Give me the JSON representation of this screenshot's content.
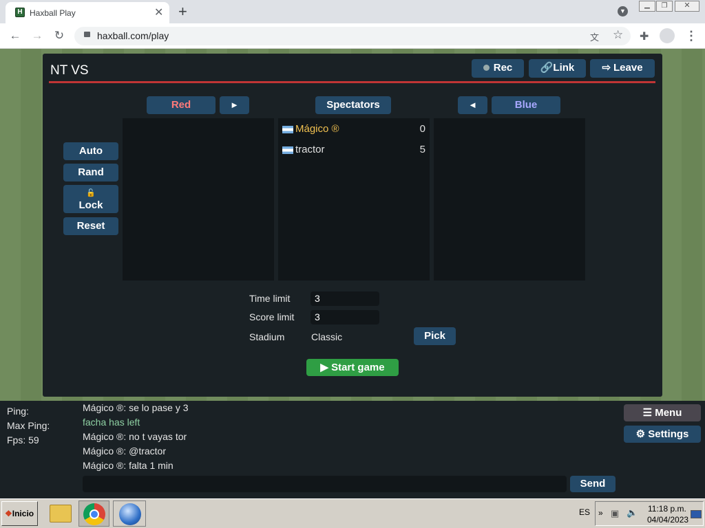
{
  "browser": {
    "tab_title": "Haxball Play",
    "url": "haxball.com/play"
  },
  "room": {
    "title": "NT VS",
    "rec_label": "Rec",
    "link_label": "Link",
    "leave_label": "Leave"
  },
  "teams": {
    "red_label": "Red",
    "red_arrow": "►",
    "spectators_label": "Spectators",
    "blue_arrow": "◄",
    "blue_label": "Blue"
  },
  "side_buttons": {
    "auto": "Auto",
    "rand": "Rand",
    "lock": "Lock",
    "reset": "Reset"
  },
  "spectators": [
    {
      "name": "Mágico ®",
      "score": "0"
    },
    {
      "name": "tractor",
      "score": "5"
    }
  ],
  "settings": {
    "time_limit_label": "Time limit",
    "time_limit_value": "3",
    "score_limit_label": "Score limit",
    "score_limit_value": "3",
    "stadium_label": "Stadium",
    "stadium_value": "Classic",
    "pick_label": "Pick"
  },
  "start_label": "▶ Start game",
  "stats": {
    "ping": "Ping:",
    "max_ping": "Max Ping:",
    "fps": "Fps: 59"
  },
  "chat": [
    "Mágico ®: se lo pase y 3",
    "facha has left",
    "Mágico ®: no t vayas tor",
    "Mágico ®: @tractor",
    "Mágico ®: falta 1 min"
  ],
  "send_label": "Send",
  "menu_label": "Menu",
  "settings_label": "Settings",
  "taskbar": {
    "start": "Inicio",
    "lang": "ES",
    "time": "11:18 p.m.",
    "date": "04/04/2023"
  },
  "colors": {
    "red_team": "#ff7a7a",
    "blue_team": "#a8a8ff",
    "start_green": "#2f9e44",
    "join_msg": "#8fd1a3"
  }
}
